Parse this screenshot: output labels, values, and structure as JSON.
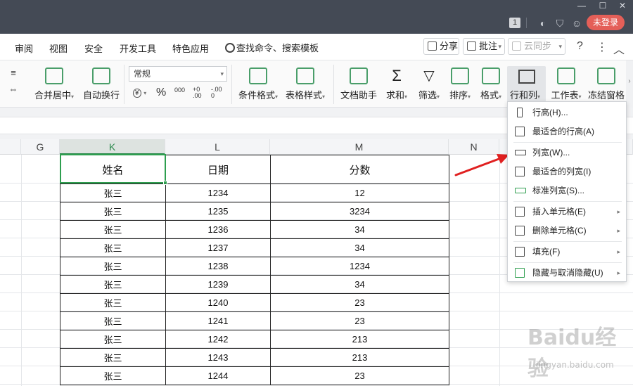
{
  "titlebar": {
    "badge": "1",
    "login": "未登录"
  },
  "menu": {
    "tabs": [
      "审阅",
      "视图",
      "安全",
      "开发工具",
      "特色应用"
    ],
    "search": "查找命令、搜索模板",
    "share": "分享",
    "annotate": "批注",
    "cloud_sync": "云同步"
  },
  "ribbon": {
    "merge_center": "合并居中",
    "auto_wrap": "自动换行",
    "number_format": "常规",
    "currency": "¥",
    "percent": "%",
    "thousands": "000",
    "inc_decimal": "+0 .00",
    "dec_decimal": "-.00 0",
    "cond_format": "条件格式",
    "table_style": "表格样式",
    "doc_helper": "文档助手",
    "sum": "求和",
    "filter": "筛选",
    "sort": "排序",
    "format": "格式",
    "row_col": "行和列",
    "worksheet": "工作表",
    "freeze": "冻结窗格"
  },
  "columns": [
    "G",
    "K",
    "L",
    "M",
    "N"
  ],
  "table": {
    "headers": [
      "姓名",
      "日期",
      "分数"
    ],
    "rows": [
      [
        "张三",
        "1234",
        "12"
      ],
      [
        "张三",
        "1235",
        "3234"
      ],
      [
        "张三",
        "1236",
        "34"
      ],
      [
        "张三",
        "1237",
        "34"
      ],
      [
        "张三",
        "1238",
        "1234"
      ],
      [
        "张三",
        "1239",
        "34"
      ],
      [
        "张三",
        "1240",
        "23"
      ],
      [
        "张三",
        "1241",
        "23"
      ],
      [
        "张三",
        "1242",
        "213"
      ],
      [
        "张三",
        "1243",
        "213"
      ],
      [
        "张三",
        "1244",
        "23"
      ]
    ]
  },
  "dropdown": {
    "items": [
      "行高(H)...",
      "最适合的行高(A)",
      "列宽(W)...",
      "最适合的列宽(I)",
      "标准列宽(S)...",
      "插入单元格(E)",
      "删除单元格(C)",
      "填充(F)",
      "隐藏与取消隐藏(U)"
    ]
  },
  "watermark": {
    "brand": "Baidu经验",
    "url": "jingyan.baidu.com"
  },
  "colors": {
    "accent": "#2e9e4f",
    "login": "#e45f58",
    "titlebar": "#444a55"
  }
}
